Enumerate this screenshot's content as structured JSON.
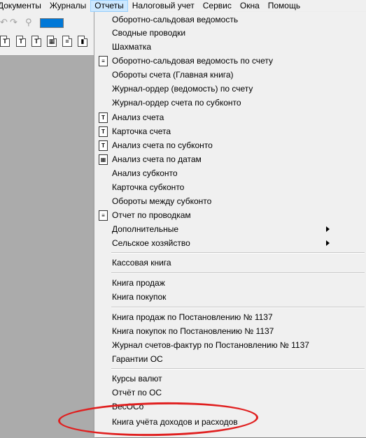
{
  "menubar": {
    "items": [
      "Документы",
      "Журналы",
      "Отчеты",
      "Налоговый учет",
      "Сервис",
      "Окна",
      "Помощь"
    ],
    "active": "Отчеты"
  },
  "toolbar": {
    "icons": [
      "report-t-icon",
      "report-tt-icon",
      "report-sub-icon",
      "report-date-icon",
      "report-doc-icon",
      "report-chart-icon"
    ]
  },
  "menu": {
    "items": [
      {
        "label": "Оборотно-сальдовая ведомость"
      },
      {
        "label": "Сводные проводки"
      },
      {
        "label": "Шахматка"
      },
      {
        "label": "Оборотно-сальдовая ведомость по счету",
        "icon": "account-sheet-icon"
      },
      {
        "label": "Обороты счета (Главная книга)"
      },
      {
        "label": "Журнал-ордер (ведомость) по счету"
      },
      {
        "label": "Журнал-ордер счета по субконто"
      },
      {
        "label": "Анализ счета",
        "icon": "account-analysis-icon"
      },
      {
        "label": "Карточка счета",
        "icon": "account-card-icon"
      },
      {
        "label": "Анализ счета по субконто",
        "icon": "subconto-analysis-icon"
      },
      {
        "label": "Анализ счета по датам",
        "icon": "date-analysis-icon"
      },
      {
        "label": "Анализ субконто"
      },
      {
        "label": "Карточка субконто"
      },
      {
        "label": "Обороты между субконто"
      },
      {
        "label": "Отчет по проводкам",
        "icon": "postings-report-icon"
      },
      {
        "label": "Дополнительные",
        "submenu": true
      },
      {
        "label": "Сельское хозяйство",
        "submenu": true
      },
      {
        "label": "Кассовая книга"
      },
      {
        "label": "Книга продаж"
      },
      {
        "label": "Книга покупок"
      },
      {
        "label": "Книга продаж по Постановлению № 1137"
      },
      {
        "label": "Книга покупок по Постановлению № 1137"
      },
      {
        "label": "Журнал счетов-фактур по Постановлению № 1137"
      },
      {
        "label": "Гарантии ОС"
      },
      {
        "label": "Курсы валют"
      },
      {
        "label": "Отчёт по ОС"
      },
      {
        "label": "ВесОСо"
      },
      {
        "label": "Книга учёта доходов и расходов"
      }
    ]
  },
  "highlight_color": "#e02020"
}
